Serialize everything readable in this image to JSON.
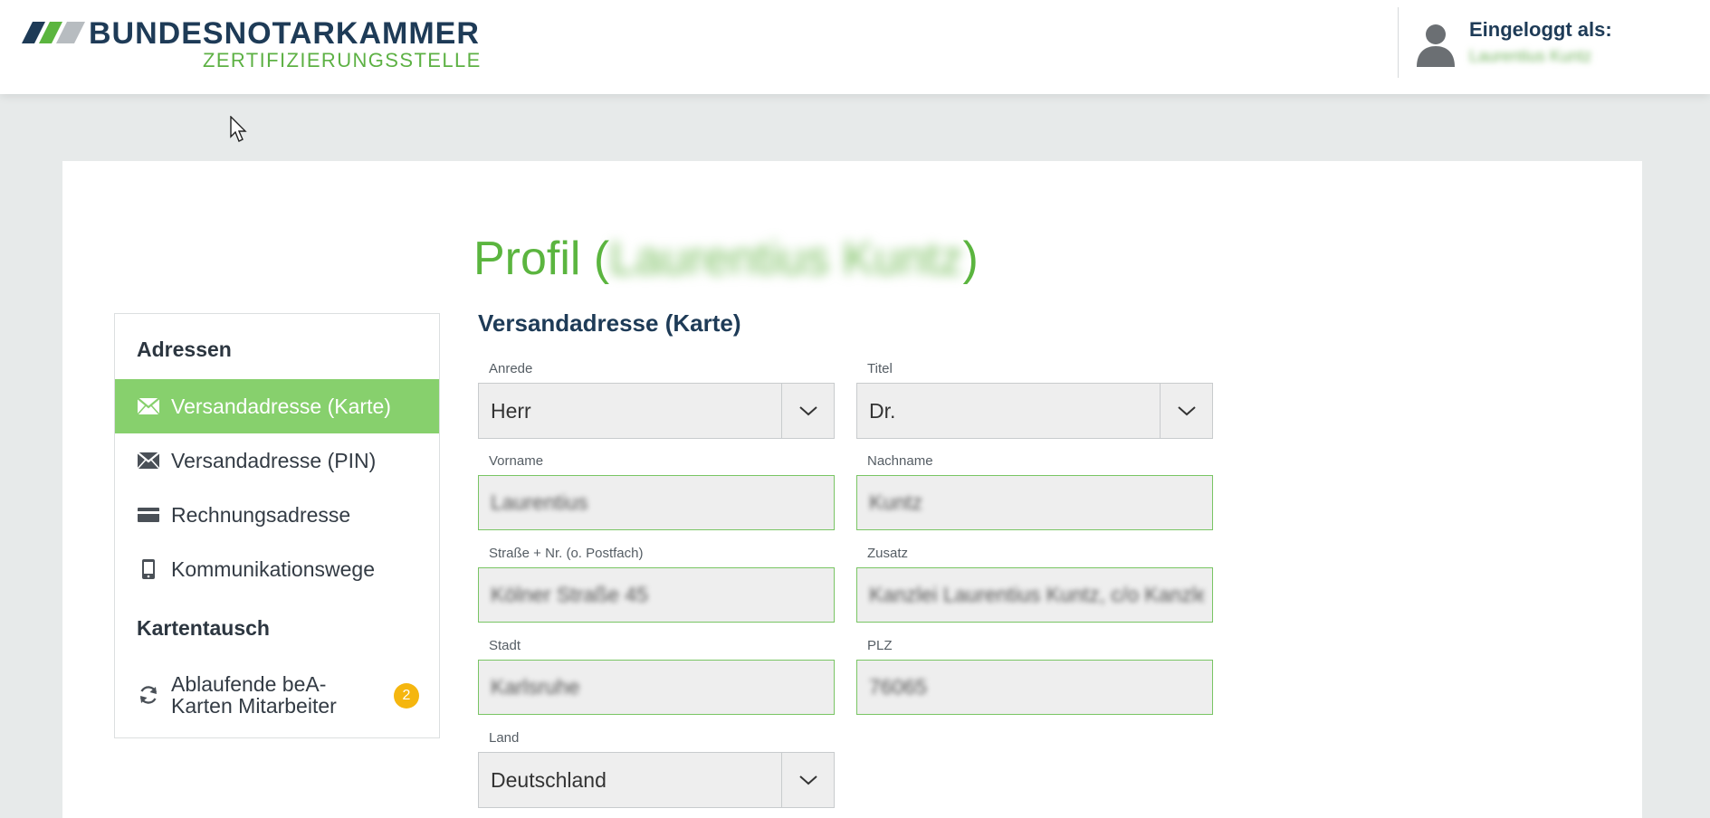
{
  "header": {
    "brand_main": "BUNDESNOTARKAMMER",
    "brand_sub": "ZERTIFIZIERUNGSSTELLE",
    "user_label": "Eingeloggt als:",
    "user_name": "Laurentius Kuntz"
  },
  "page": {
    "title_prefix": "Profil (",
    "title_name": "Laurentius Kuntz",
    "title_suffix": ")"
  },
  "sidebar": {
    "heading_addresses": "Adressen",
    "items": [
      {
        "label": "Versandadresse (Karte)",
        "icon": "envelope-icon",
        "active": true
      },
      {
        "label": "Versandadresse (PIN)",
        "icon": "envelope-icon",
        "active": false
      },
      {
        "label": "Rechnungsadresse",
        "icon": "credit-card-icon",
        "active": false
      },
      {
        "label": "Kommunikationswege",
        "icon": "mobile-phone-icon",
        "active": false
      }
    ],
    "heading_exchange": "Kartentausch",
    "exchange_item": {
      "label": "Ablaufende beA-Karten Mitarbeiter",
      "icon": "refresh-icon",
      "badge": "2"
    }
  },
  "form": {
    "section_title": "Versandadresse (Karte)",
    "anrede": {
      "label": "Anrede",
      "value": "Herr"
    },
    "titel": {
      "label": "Titel",
      "value": "Dr."
    },
    "vorname": {
      "label": "Vorname",
      "value": "Laurentius"
    },
    "nachname": {
      "label": "Nachname",
      "value": "Kuntz"
    },
    "strasse": {
      "label": "Straße + Nr. (o. Postfach)",
      "value": "Kölner Straße 45"
    },
    "zusatz": {
      "label": "Zusatz",
      "value": "Kanzlei Laurentius Kuntz, c/o Kanzlei"
    },
    "stadt": {
      "label": "Stadt",
      "value": "Karlsruhe"
    },
    "plz": {
      "label": "PLZ",
      "value": "76065"
    },
    "land": {
      "label": "Land",
      "value": "Deutschland"
    }
  },
  "colors": {
    "brand_blue": "#1e3b57",
    "brand_green": "#5bb53f",
    "active_item": "#87d06d",
    "badge": "#f5b60f"
  }
}
